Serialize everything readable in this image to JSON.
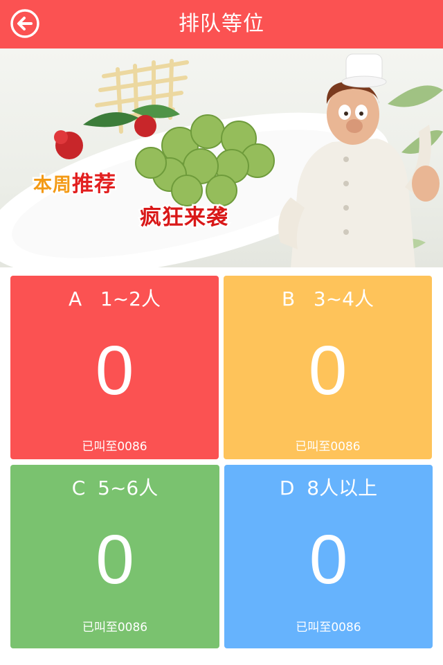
{
  "header": {
    "title": "排队等位",
    "back_icon": "back-arrow-icon"
  },
  "banner": {
    "promo_part1": "本周",
    "promo_part2": "推荐",
    "promo_line2": "疯狂来袭",
    "colors": {
      "orange": "#f39a15",
      "red": "#e21f1f"
    }
  },
  "queues": [
    {
      "letter": "A",
      "size": "1~2人",
      "count": "0",
      "called": "已叫至0086",
      "color": "#fb5252"
    },
    {
      "letter": "B",
      "size": "3~4人",
      "count": "0",
      "called": "已叫至0086",
      "color": "#fec35a"
    },
    {
      "letter": "C",
      "size": "5~6人",
      "count": "0",
      "called": "已叫至0086",
      "color": "#7ac26f"
    },
    {
      "letter": "D",
      "size": "8人以上",
      "count": "0",
      "called": "已叫至0086",
      "color": "#66b3fd"
    }
  ],
  "theme": {
    "header_bg": "#fb5252"
  }
}
